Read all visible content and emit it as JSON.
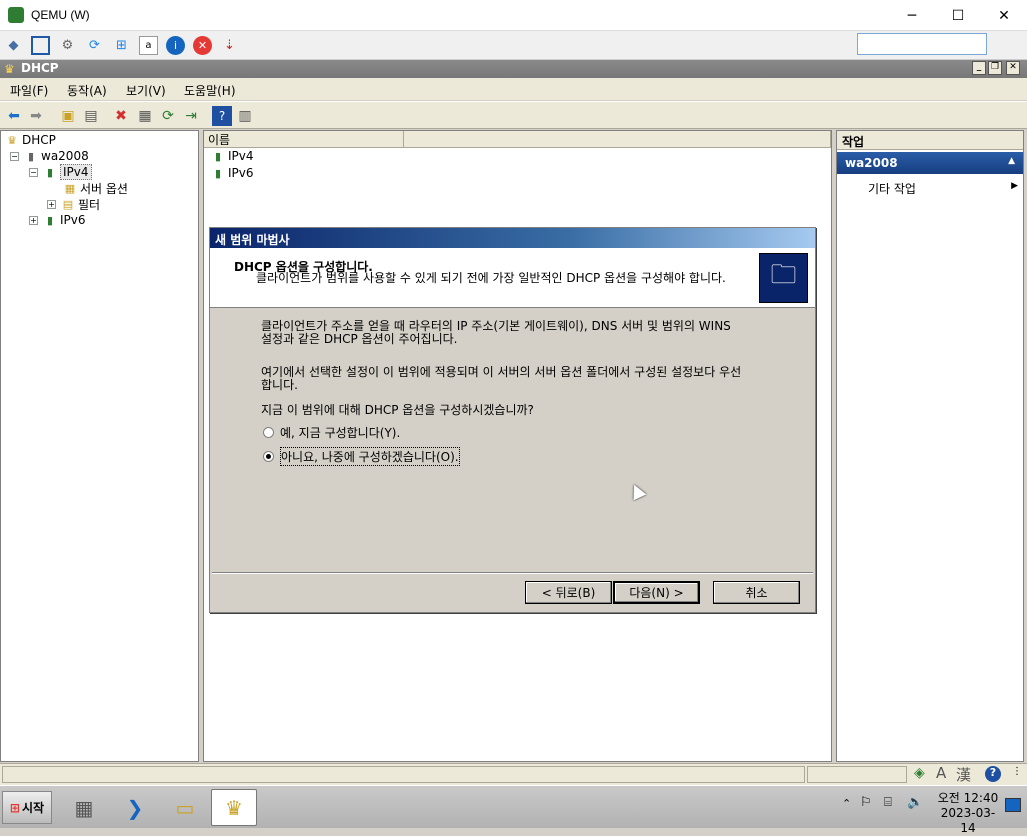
{
  "host_window": {
    "title": "QEMU (W)",
    "minimize": "─",
    "maximize": "☐",
    "close": "✕"
  },
  "mmc": {
    "title": "DHCP",
    "menu": [
      "파일(F)",
      "동작(A)",
      "보기(V)",
      "도움말(H)"
    ]
  },
  "tree": {
    "root": "DHCP",
    "server": "wa2008",
    "ipv4": "IPv4",
    "server_options": "서버 옵션",
    "filters": "필터",
    "ipv6": "IPv6"
  },
  "list": {
    "column_name": "이름",
    "items": [
      "IPv4",
      "IPv6"
    ]
  },
  "actions": {
    "header": "작업",
    "section": "wa2008",
    "more": "기타 작업"
  },
  "wizard": {
    "title": "새 범위 마법사",
    "heading": "DHCP 옵션을 구성합니다.",
    "subheading": "클라이언트가 범위를 사용할 수 있게 되기 전에 가장 일반적인 DHCP 옵션을 구성해야 합니다.",
    "para1": "클라이언트가 주소를 얻을 때 라우터의 IP 주소(기본 게이트웨이), DNS 서버 및 범위의 WINS 설정과 같은 DHCP 옵션이 주어집니다.",
    "para2": "여기에서 선택한 설정이 이 범위에 적용되며 이 서버의 서버 옵션 폴더에서 구성된 설정보다 우선합니다.",
    "question": "지금 이 범위에 대해 DHCP 옵션을 구성하시겠습니까?",
    "option_yes": "예, 지금 구성합니다(Y).",
    "option_no": "아니요, 나중에 구성하겠습니다(O).",
    "selected": "no",
    "back": "< 뒤로(B)",
    "next": "다음(N) >",
    "cancel": "취소"
  },
  "taskbar": {
    "start": "시작",
    "time": "오전 12:40",
    "date": "2023-03-14"
  }
}
